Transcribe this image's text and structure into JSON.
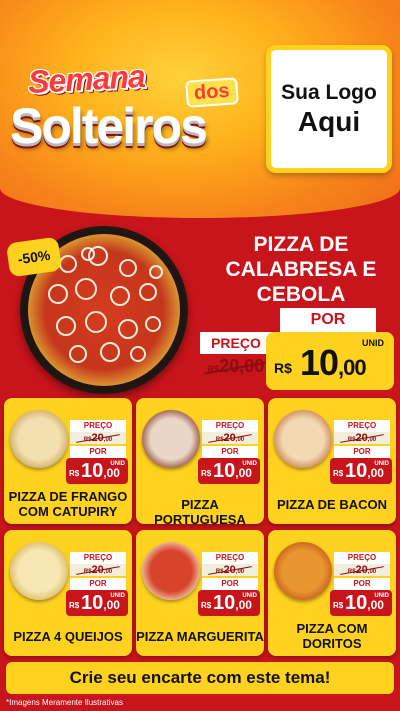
{
  "header": {
    "brand_line1": "Semana",
    "brand_dos": "dos",
    "brand_line2": "Solteiros",
    "logo_line1": "Sua Logo",
    "logo_line2": "Aqui"
  },
  "featured": {
    "discount": "-50%",
    "title": "PIZZA DE CALABRESA E CEBOLA",
    "preco_label": "PREÇO",
    "old_currency": "R$",
    "old_value": "20,00",
    "por_label": "POR",
    "unid_label": "UNID",
    "currency": "R$",
    "price_int": "10",
    "price_cents": ",00"
  },
  "products": [
    {
      "name": "PIZZA DE FRANGO COM CATUPIRY",
      "preco_label": "PREÇO",
      "old_currency": "R$",
      "old_int": "20",
      "old_cents": ",00",
      "por_label": "POR",
      "currency": "R$",
      "price_int": "10",
      "price_cents": ",00",
      "unid": "UNID",
      "colors": [
        "#f3e0b0",
        "#c9a35c"
      ]
    },
    {
      "name": "PIZZA PORTUGUESA",
      "preco_label": "PREÇO",
      "old_currency": "R$",
      "old_int": "20",
      "old_cents": ",00",
      "por_label": "POR",
      "currency": "R$",
      "price_int": "10",
      "price_cents": ",00",
      "unid": "UNID",
      "colors": [
        "#e9d6c6",
        "#8a3b2c"
      ]
    },
    {
      "name": "PIZZA DE BACON",
      "preco_label": "PREÇO",
      "old_currency": "R$",
      "old_int": "20",
      "old_cents": ",00",
      "por_label": "POR",
      "currency": "R$",
      "price_int": "10",
      "price_cents": ",00",
      "unid": "UNID",
      "colors": [
        "#f2d9b2",
        "#c9764a"
      ]
    },
    {
      "name": "PIZZA 4 QUEIJOS",
      "preco_label": "PREÇO",
      "old_currency": "R$",
      "old_int": "20",
      "old_cents": ",00",
      "por_label": "POR",
      "currency": "R$",
      "price_int": "10",
      "price_cents": ",00",
      "unid": "UNID",
      "colors": [
        "#f6e7b3",
        "#d9b35c"
      ]
    },
    {
      "name": "PIZZA MARGUERITA",
      "preco_label": "PREÇO",
      "old_currency": "R$",
      "old_int": "20",
      "old_cents": ",00",
      "por_label": "POR",
      "currency": "R$",
      "price_int": "10",
      "price_cents": ",00",
      "unid": "UNID",
      "colors": [
        "#d7442a",
        "#f2e3c4"
      ]
    },
    {
      "name": "PIZZA COM DORITOS",
      "preco_label": "PREÇO",
      "old_currency": "R$",
      "old_int": "20",
      "old_cents": ",00",
      "por_label": "POR",
      "currency": "R$",
      "price_int": "10",
      "price_cents": ",00",
      "unid": "UNID",
      "colors": [
        "#e8962f",
        "#c4561c"
      ]
    }
  ],
  "cta": "Crie seu encarte com este tema!",
  "disclaimer": "*Imagens Meramente Ilustrativas"
}
